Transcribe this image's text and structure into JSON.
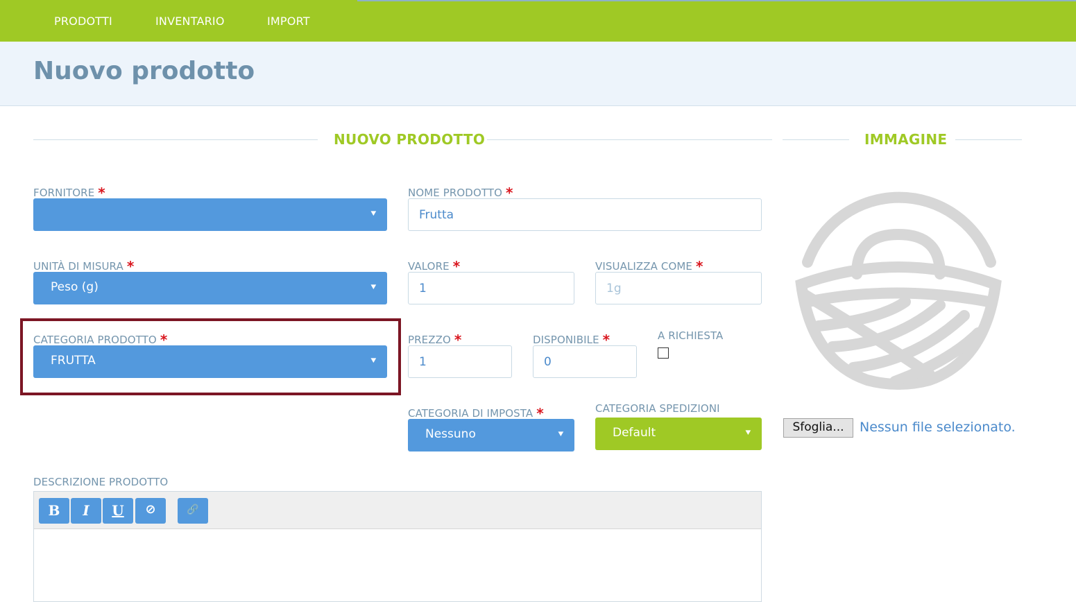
{
  "nav": {
    "items": [
      "PRODOTTI",
      "INVENTARIO",
      "IMPORT"
    ]
  },
  "page": {
    "title": "Nuovo prodotto"
  },
  "sections": {
    "product": "NUOVO PRODOTTO",
    "image": "IMMAGINE"
  },
  "required_mark": "*",
  "fields": {
    "fornitore": {
      "label": "FORNITORE",
      "value": ""
    },
    "nome_prodotto": {
      "label": "NOME PRODOTTO",
      "value": "Frutta"
    },
    "unita_misura": {
      "label": "UNITÀ DI MISURA",
      "value": "Peso (g)"
    },
    "valore": {
      "label": "VALORE",
      "value": "1"
    },
    "visualizza_come": {
      "label": "VISUALIZZA COME",
      "placeholder": "1g"
    },
    "categoria_prodotto": {
      "label": "CATEGORIA PRODOTTO",
      "value": "FRUTTA"
    },
    "prezzo": {
      "label": "PREZZO",
      "value": "1"
    },
    "disponibile": {
      "label": "DISPONIBILE",
      "value": "0"
    },
    "a_richiesta": {
      "label": "A RICHIESTA",
      "checked": false
    },
    "categoria_imposta": {
      "label": "CATEGORIA DI IMPOSTA",
      "value": "Nessuno"
    },
    "categoria_spedizioni": {
      "label": "CATEGORIA SPEDIZIONI",
      "value": "Default"
    },
    "descrizione": {
      "label": "DESCRIZIONE PRODOTTO"
    }
  },
  "file_upload": {
    "button": "Sfoglia...",
    "status": "Nessun file selezionato."
  },
  "editor_toolbar": [
    {
      "name": "bold-button",
      "glyph": "B"
    },
    {
      "name": "italic-button",
      "glyph": "I"
    },
    {
      "name": "underline-button",
      "glyph": "U"
    },
    {
      "name": "clear-format-button",
      "glyph": "⊘"
    },
    {
      "name": "link-button",
      "glyph": "🔗"
    }
  ],
  "colors": {
    "brand_green": "#9fc925",
    "select_blue": "#5399dd",
    "header_band": "#edf4fb",
    "highlight": "#7c1624",
    "required": "#d9171f"
  }
}
